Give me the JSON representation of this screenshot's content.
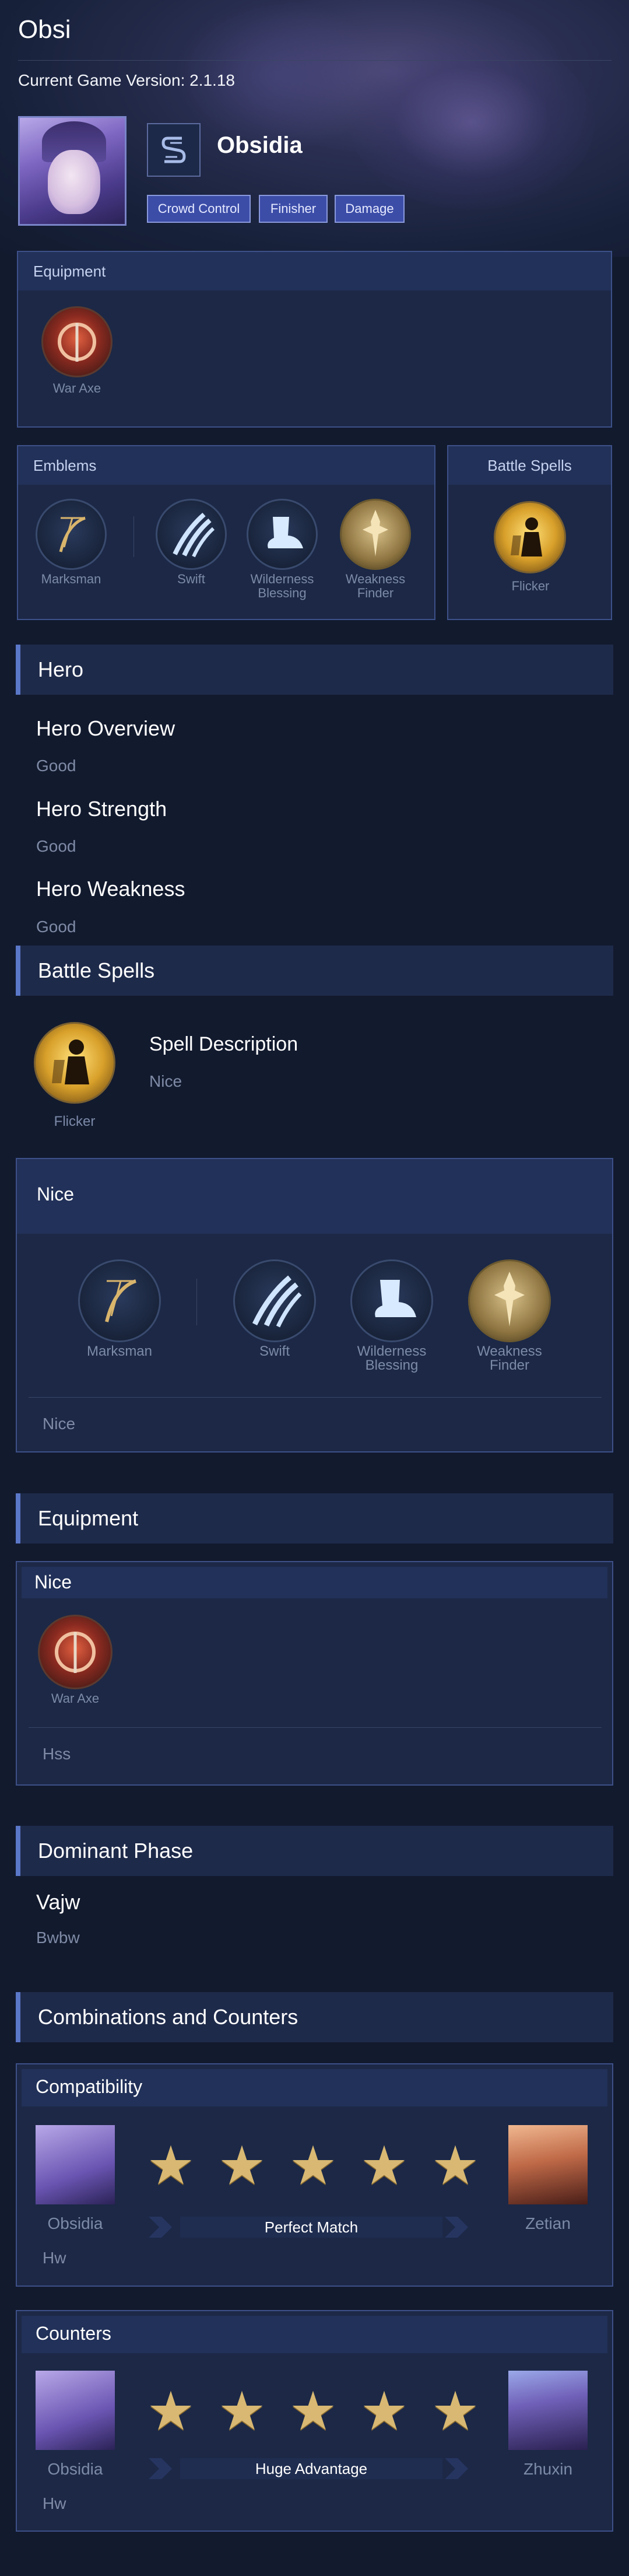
{
  "header": {
    "title": "Obsi",
    "version": "Current Game Version: 2.1.18",
    "hero_name": "Obsidia",
    "role_icon": "s-rune-icon",
    "tags": [
      "Crowd Control",
      "Finisher",
      "Damage"
    ]
  },
  "equipment_card": {
    "title": "Equipment",
    "items": [
      {
        "label": "War Axe",
        "icon": "war-axe-icon"
      }
    ]
  },
  "emblems_card": {
    "title": "Emblems",
    "items": [
      {
        "label": "Marksman",
        "icon": "bow-icon"
      },
      {
        "label": "Swift",
        "icon": "claw-icon"
      },
      {
        "label": "Wilderness Blessing",
        "icon": "boot-icon"
      },
      {
        "label": "Weakness Finder",
        "icon": "sword-emblem-icon"
      }
    ]
  },
  "battle_spells_card": {
    "title": "Battle Spells",
    "items": [
      {
        "label": "Flicker",
        "icon": "flicker-icon"
      }
    ]
  },
  "hero_section": {
    "title": "Hero",
    "overview_title": "Hero Overview",
    "overview_text": "Good",
    "strength_title": "Hero Strength",
    "strength_text": "Good",
    "weakness_title": "Hero Weakness",
    "weakness_text": "Good"
  },
  "battle_spells_section": {
    "title": "Battle Spells",
    "spell_label": "Flicker",
    "desc_title": "Spell Description",
    "desc_text": "Nice"
  },
  "emblem_detail": {
    "title": "Nice",
    "items": [
      {
        "label": "Marksman"
      },
      {
        "label": "Swift"
      },
      {
        "label": "Wilderness Blessing"
      },
      {
        "label": "Weakness Finder"
      }
    ],
    "note": "Nice"
  },
  "equipment_section": {
    "title": "Equipment",
    "card_title": "Nice",
    "item_label": "War Axe",
    "note": "Hss"
  },
  "dominant_phase": {
    "title": "Dominant Phase",
    "heading": "Vajw",
    "text": "Bwbw"
  },
  "combos": {
    "title": "Combinations and Counters",
    "compatibility": {
      "title": "Compatibility",
      "left_hero": "Obsidia",
      "right_hero": "Zetian",
      "stars": 5,
      "banner": "Perfect Match",
      "note": "Hw"
    },
    "counters": {
      "title": "Counters",
      "left_hero": "Obsidia",
      "right_hero": "Zhuxin",
      "stars": 5,
      "banner": "Huge Advantage",
      "note": "Hw"
    }
  },
  "colors": {
    "background": "#121a2e",
    "card": "#1c2846",
    "accent": "#5a77c8",
    "tag": "#3c4da8",
    "star": "#d8b872"
  }
}
